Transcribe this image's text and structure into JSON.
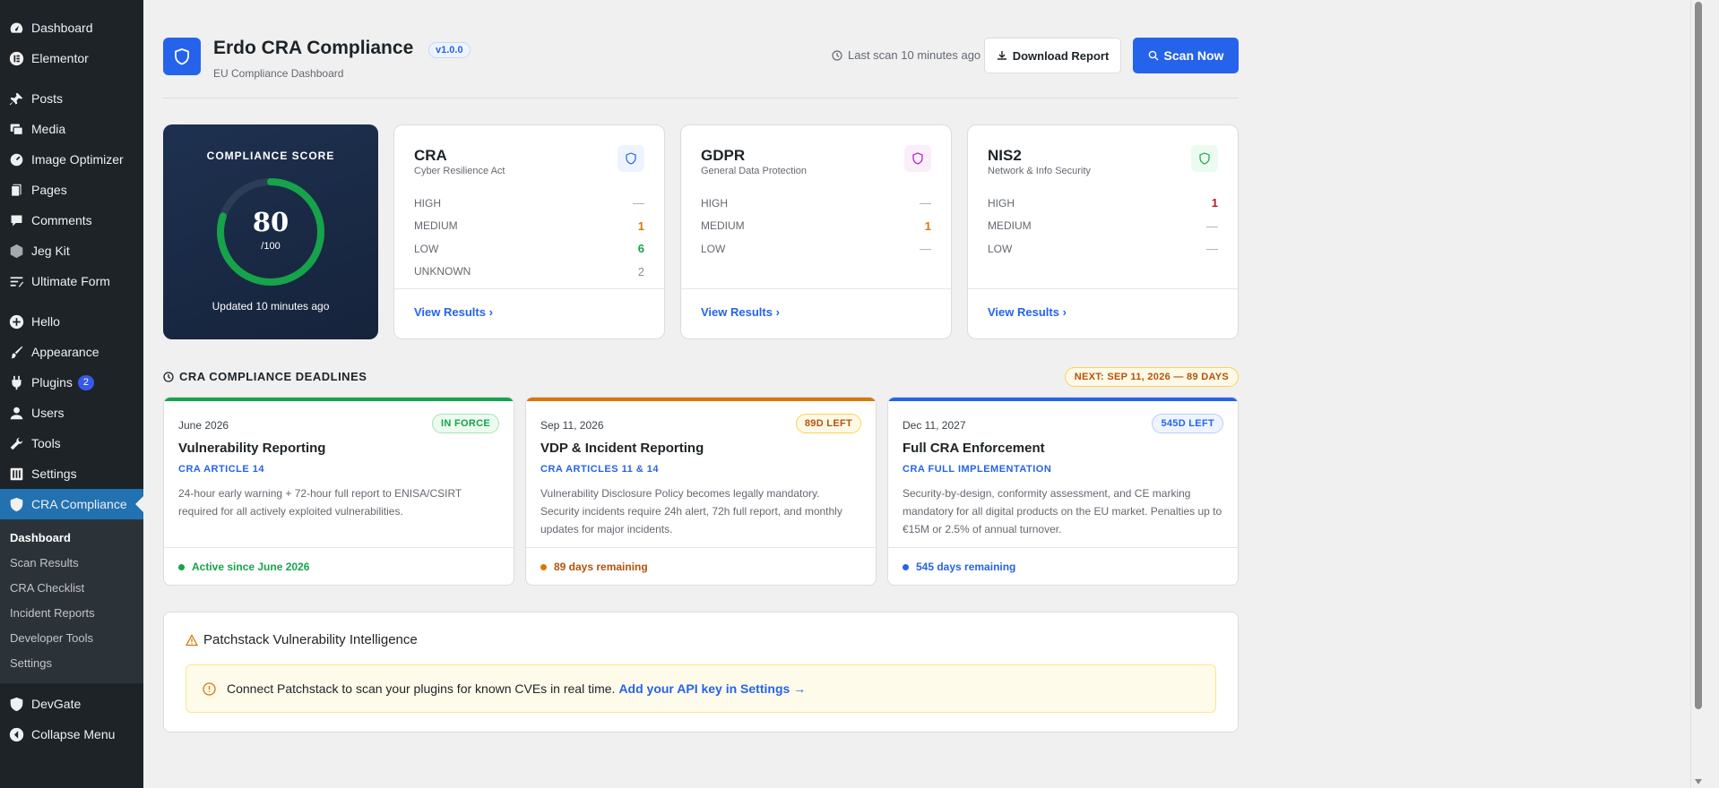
{
  "sidebar": {
    "items": [
      {
        "label": "Dashboard",
        "icon": "dashboard-icon"
      },
      {
        "label": "Elementor",
        "icon": "elementor-icon"
      },
      {
        "label": "Posts",
        "icon": "pin-icon"
      },
      {
        "label": "Media",
        "icon": "media-icon"
      },
      {
        "label": "Image Optimizer",
        "icon": "gauge-icon"
      },
      {
        "label": "Pages",
        "icon": "pages-icon"
      },
      {
        "label": "Comments",
        "icon": "comment-icon"
      },
      {
        "label": "Jeg Kit",
        "icon": "hexagon-icon"
      },
      {
        "label": "Ultimate Form",
        "icon": "form-icon"
      },
      {
        "label": "Hello",
        "icon": "plus-circle-icon"
      },
      {
        "label": "Appearance",
        "icon": "brush-icon"
      },
      {
        "label": "Plugins",
        "icon": "plug-icon",
        "badge": "2"
      },
      {
        "label": "Users",
        "icon": "user-icon"
      },
      {
        "label": "Tools",
        "icon": "wrench-icon"
      },
      {
        "label": "Settings",
        "icon": "settings-icon"
      },
      {
        "label": "CRA Compliance",
        "icon": "shield-icon"
      }
    ],
    "submenu": [
      "Dashboard",
      "Scan Results",
      "CRA Checklist",
      "Incident Reports",
      "Developer Tools",
      "Settings"
    ],
    "after": [
      {
        "label": "DevGate",
        "icon": "shield-icon"
      },
      {
        "label": "Collapse Menu",
        "icon": "collapse-icon"
      }
    ]
  },
  "header": {
    "title": "Erdo CRA Compliance",
    "version": "v1.0.0",
    "subtitle": "EU Compliance Dashboard",
    "last_scan": "Last scan 10 minutes ago",
    "download_label": "Download Report",
    "scan_label": "Scan Now"
  },
  "score": {
    "label": "COMPLIANCE SCORE",
    "value": "80",
    "denom": "/100",
    "fraction": 0.8,
    "updated": "Updated 10 minutes ago"
  },
  "regulations": [
    {
      "name": "CRA",
      "sub": "Cyber Resilience Act",
      "icon_color": "#2563eb",
      "icon_bg": "#eef4ff",
      "rows": [
        {
          "k": "HIGH",
          "v": "—"
        },
        {
          "k": "MEDIUM",
          "v": "1"
        },
        {
          "k": "LOW",
          "v": "6"
        },
        {
          "k": "UNKNOWN",
          "v": "2"
        }
      ],
      "link": "View Results"
    },
    {
      "name": "GDPR",
      "sub": "General Data Protection",
      "icon_color": "#a21caf",
      "icon_bg": "#fbeefb",
      "rows": [
        {
          "k": "HIGH",
          "v": "—"
        },
        {
          "k": "MEDIUM",
          "v": "1"
        },
        {
          "k": "LOW",
          "v": "—"
        }
      ],
      "link": "View Results"
    },
    {
      "name": "NIS2",
      "sub": "Network & Info Security",
      "icon_color": "#16a34a",
      "icon_bg": "#ecfbef",
      "rows": [
        {
          "k": "HIGH",
          "v": "1"
        },
        {
          "k": "MEDIUM",
          "v": "—"
        },
        {
          "k": "LOW",
          "v": "—"
        }
      ],
      "link": "View Results"
    }
  ],
  "deadlines": {
    "title": "CRA COMPLIANCE DEADLINES",
    "next": "NEXT: SEP 11, 2026 — 89 DAYS",
    "cards": [
      {
        "date": "June 2026",
        "pill": "IN FORCE",
        "name": "Vulnerability Reporting",
        "article": "CRA ARTICLE 14",
        "desc": "24-hour early warning + 72-hour full report to ENISA/CSIRT required for all actively exploited vulnerabilities.",
        "status": "Active since June 2026",
        "color": "#16a34a"
      },
      {
        "date": "Sep 11, 2026",
        "pill": "89D LEFT",
        "name": "VDP & Incident Reporting",
        "article": "CRA ARTICLES 11 & 14",
        "desc": "Vulnerability Disclosure Policy becomes legally mandatory. Security incidents require 24h alert, 72h full report, and monthly updates for major incidents.",
        "status": "89 days remaining",
        "color": "#d97706"
      },
      {
        "date": "Dec 11, 2027",
        "pill": "545D LEFT",
        "name": "Full CRA Enforcement",
        "article": "CRA FULL IMPLEMENTATION",
        "desc": "Security-by-design, conformity assessment, and CE marking mandatory for all digital products on the EU market. Penalties up to €15M or 2.5% of annual turnover.",
        "status": "545 days remaining",
        "color": "#2563eb"
      }
    ]
  },
  "patchstack": {
    "title": "Patchstack Vulnerability Intelligence",
    "message": "Connect Patchstack to scan your plugins for known CVEs in real time.",
    "link": "Add your API key in Settings →"
  }
}
